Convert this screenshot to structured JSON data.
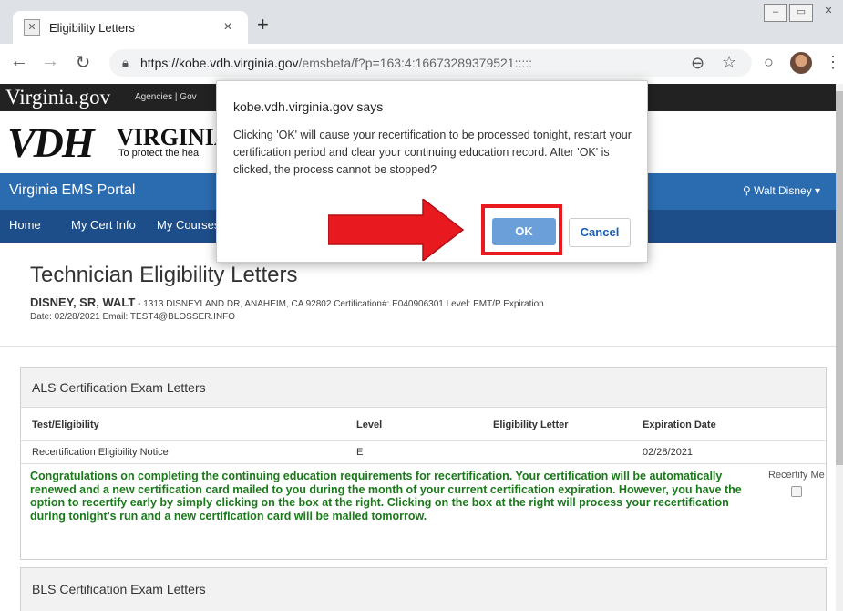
{
  "browser": {
    "tab_title": "Eligibility Letters",
    "tab_close": "×",
    "new_tab": "+",
    "url_host": "https://kobe.vdh.virginia.gov",
    "url_path": "/emsbeta/f?p=163:4:16673289379521:::::",
    "win_min": "–",
    "win_max": "▭",
    "win_close": "✕"
  },
  "site": {
    "vagov_brand": "Virginia.gov",
    "vagov_links": "Agencies | Gov",
    "vdh_logo": "VDH",
    "vdh_name": "VIRGINIA",
    "vdh_tagline": "To protect the hea",
    "portal_name": "Virginia EMS Portal",
    "user_name": "Walt Disney ▾"
  },
  "menu": [
    "Home",
    "My Cert Info",
    "My Courses"
  ],
  "page": {
    "title": "Technician Eligibility Letters",
    "tech_name": "DISNEY, SR, WALT",
    "tech_details": " - 1313 DISNEYLAND DR, ANAHEIM, CA 92802   Certification#: E040906301   Level: EMT/P   Expiration",
    "tech_details2": "Date: 02/28/2021   Email: TEST4@BLOSSER.INFO"
  },
  "als": {
    "header": "ALS Certification Exam Letters",
    "columns": [
      "Test/Eligibility",
      "Level",
      "Eligibility Letter",
      "Expiration Date"
    ],
    "rows": [
      {
        "test": "Recertification Eligibility Notice",
        "level": "E",
        "letter": "",
        "expiration": "02/28/2021"
      }
    ],
    "congrats": "Congratulations on completing the continuing education requirements for recertification. Your certification will be automatically renewed and a new certification card mailed to you during the month of your current certification expiration. However, you have the option to recertify early by simply clicking on the box at the right. Clicking on the box at the right will process your recertification during tonight's run and a new certification card will be mailed tomorrow.",
    "recertify_label": "Recertify Me"
  },
  "bls": {
    "header": "BLS Certification Exam Letters"
  },
  "dialog": {
    "title": "kobe.vdh.virginia.gov says",
    "message": "Clicking 'OK' will cause your recertification to be processed tonight, restart your certification period and clear your continuing education record.  After 'OK' is clicked, the process cannot be stopped?",
    "ok_label": "OK",
    "cancel_label": "Cancel"
  },
  "colors": {
    "portal_blue": "#2b6cb0",
    "menu_blue": "#1e4e8a",
    "congrats_green": "#1a7a1a",
    "annotation_red": "#e8191f"
  }
}
